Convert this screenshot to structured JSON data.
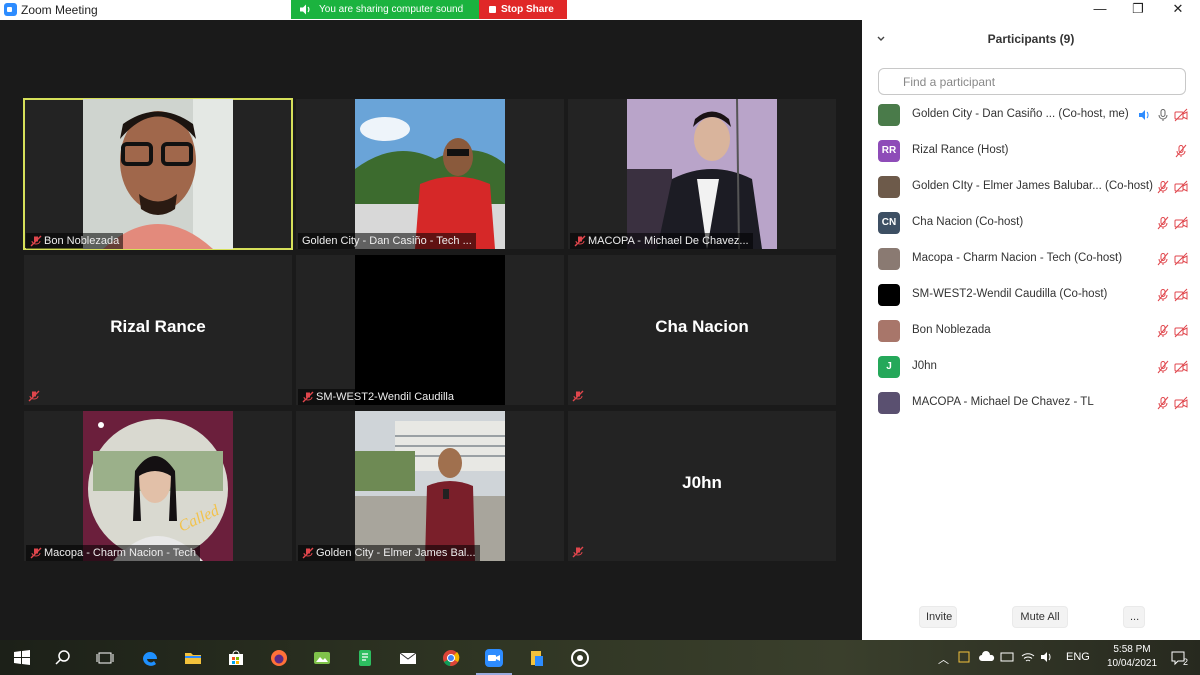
{
  "window": {
    "title": "Zoom Meeting",
    "minimize": "—",
    "restore": "❐",
    "close": "✕"
  },
  "share_banner": {
    "status": "You are sharing computer sound",
    "stop_label": "Stop Share"
  },
  "tiles": [
    {
      "label": "Bon Noblezada",
      "video": true,
      "active": true
    },
    {
      "label": "Golden City - Dan Casiño - Tech ...",
      "video": true
    },
    {
      "label": "MACOPA - Michael De Chavez...",
      "video": true
    },
    {
      "center_name": "Rizal Rance",
      "video": false
    },
    {
      "label": "SM-WEST2-Wendil Caudilla",
      "video": "black"
    },
    {
      "center_name": "Cha Nacion",
      "video": false
    },
    {
      "label": "Macopa - Charm Nacion - Tech",
      "video": true
    },
    {
      "label": "Golden City - Elmer James Bal...",
      "video": true
    },
    {
      "center_name": "J0hn",
      "video": false
    }
  ],
  "participants_panel": {
    "title": "Participants (9)",
    "search_placeholder": "Find a participant",
    "participants": [
      {
        "name": "Golden City - Dan Casiño ... (Co-host, me)",
        "avatar": "photo",
        "color": "#4a7b4a"
      },
      {
        "name": "Rizal Rance (Host)",
        "avatar": "RR",
        "color": "#8e4cb8"
      },
      {
        "name": "Golden CIty - Elmer James Balubar... (Co-host)",
        "avatar": "photo",
        "color": "#6d5a4a"
      },
      {
        "name": "Cha Nacion (Co-host)",
        "avatar": "CN",
        "color": "#3d4f63"
      },
      {
        "name": "Macopa - Charm Nacion - Tech (Co-host)",
        "avatar": "photo",
        "color": "#8a7a72"
      },
      {
        "name": "SM-WEST2-Wendil Caudilla (Co-host)",
        "avatar": "",
        "color": "#000000"
      },
      {
        "name": "Bon Noblezada",
        "avatar": "photo",
        "color": "#a8766a"
      },
      {
        "name": "J0hn",
        "avatar": "J",
        "color": "#25a85a"
      },
      {
        "name": "MACOPA - Michael De Chavez - TL",
        "avatar": "photo",
        "color": "#5a5070"
      }
    ],
    "invite_label": "Invite",
    "mute_all_label": "Mute All",
    "more_label": "..."
  },
  "taskbar": {
    "time": "5:58 PM",
    "date": "10/04/2021",
    "language": "ENG",
    "notifications": "2"
  },
  "colors": {
    "accent": "#2d8cff",
    "share_green": "#1bb33f",
    "stop_red": "#e02828",
    "mute_red": "#e0464c",
    "active_border": "#d6e05a"
  }
}
